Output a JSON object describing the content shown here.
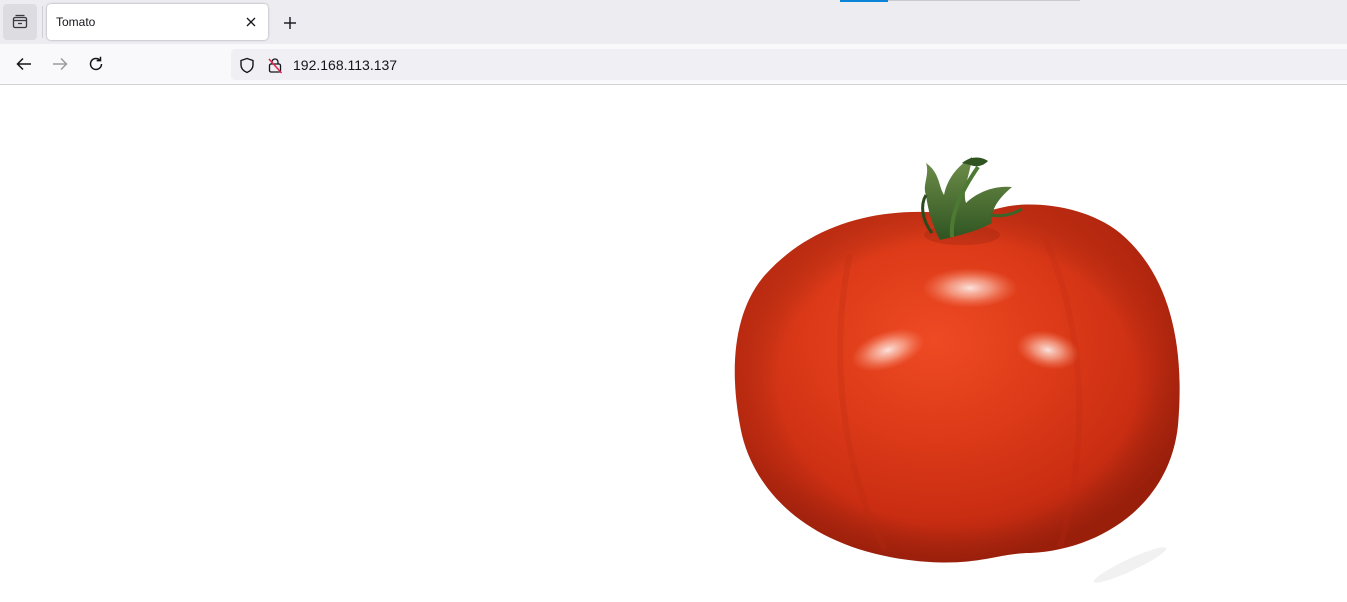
{
  "tabs": [
    {
      "title": "Tomato",
      "active": true
    }
  ],
  "address_bar": {
    "url": "192.168.113.137"
  },
  "icons": {
    "tab_list": "tab-list-icon",
    "close_tab": "close-icon",
    "new_tab": "plus-icon",
    "back": "arrow-left-icon",
    "forward": "arrow-right-icon",
    "reload": "reload-icon",
    "tracking_protection": "shield-icon",
    "connection_not_secure": "lock-strike-icon"
  },
  "colors": {
    "tab_strip": "#ececf1",
    "nav_bar": "#f9f9fb",
    "url_field": "#f0f0f4",
    "accent": "#0a84d6",
    "tomato": "#d9361b",
    "stem": "#3c6b2a"
  },
  "main": {
    "image": {
      "subject": "tomato"
    }
  }
}
